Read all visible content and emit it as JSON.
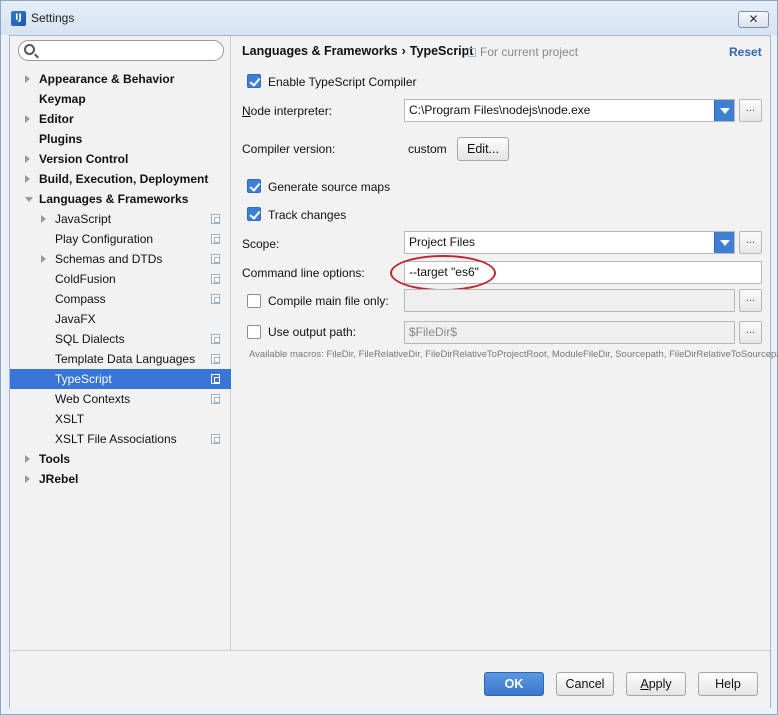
{
  "window": {
    "title": "Settings",
    "close_label": "✕"
  },
  "search": {
    "placeholder": ""
  },
  "tree": {
    "items": [
      {
        "label": "Appearance & Behavior",
        "bold": true,
        "expander": "right",
        "project_icon": false
      },
      {
        "label": "Keymap",
        "bold": true,
        "expander": "none",
        "project_icon": false
      },
      {
        "label": "Editor",
        "bold": true,
        "expander": "right",
        "project_icon": false
      },
      {
        "label": "Plugins",
        "bold": true,
        "expander": "none",
        "project_icon": false
      },
      {
        "label": "Version Control",
        "bold": true,
        "expander": "right",
        "project_icon": false
      },
      {
        "label": "Build, Execution, Deployment",
        "bold": true,
        "expander": "right",
        "project_icon": false
      },
      {
        "label": "Languages & Frameworks",
        "bold": true,
        "expander": "down",
        "project_icon": false
      },
      {
        "label": "JavaScript",
        "bold": false,
        "expander": "right",
        "project_icon": true
      },
      {
        "label": "Play Configuration",
        "bold": false,
        "expander": "none",
        "project_icon": true
      },
      {
        "label": "Schemas and DTDs",
        "bold": false,
        "expander": "right",
        "project_icon": true
      },
      {
        "label": "ColdFusion",
        "bold": false,
        "expander": "none",
        "project_icon": true
      },
      {
        "label": "Compass",
        "bold": false,
        "expander": "none",
        "project_icon": true
      },
      {
        "label": "JavaFX",
        "bold": false,
        "expander": "none",
        "project_icon": false
      },
      {
        "label": "SQL Dialects",
        "bold": false,
        "expander": "none",
        "project_icon": true
      },
      {
        "label": "Template Data Languages",
        "bold": false,
        "expander": "none",
        "project_icon": true
      },
      {
        "label": "TypeScript",
        "bold": false,
        "expander": "none",
        "project_icon": true,
        "selected": true
      },
      {
        "label": "Web Contexts",
        "bold": false,
        "expander": "none",
        "project_icon": true
      },
      {
        "label": "XSLT",
        "bold": false,
        "expander": "none",
        "project_icon": false
      },
      {
        "label": "XSLT File Associations",
        "bold": false,
        "expander": "none",
        "project_icon": true
      },
      {
        "label": "Tools",
        "bold": true,
        "expander": "right",
        "project_icon": false
      },
      {
        "label": "JRebel",
        "bold": true,
        "expander": "right",
        "project_icon": false
      }
    ]
  },
  "header": {
    "crumb_parent": "Languages & Frameworks",
    "crumb_separator": "›",
    "crumb_current": "TypeScript",
    "scope_note": "For current project",
    "reset_label": "Reset"
  },
  "form": {
    "enable_compiler_label": "Enable TypeScript Compiler",
    "enable_compiler_checked": true,
    "node_interpreter_label_first": "N",
    "node_interpreter_label_rest": "ode interpreter:",
    "node_interpreter_value": "C:\\Program Files\\nodejs\\node.exe",
    "dots_label": "...",
    "compiler_version_label": "Compiler version:",
    "compiler_version_value": "custom",
    "edit_label": "Edit...",
    "source_maps_label": "Generate source maps",
    "source_maps_checked": true,
    "track_changes_label": "Track changes",
    "track_changes_checked": true,
    "scope_label": "Scope:",
    "scope_value": "Project Files",
    "cmd_options_label": "Command line options:",
    "cmd_options_value": "--target \"es6\"",
    "compile_main_label": "Compile main file only:",
    "compile_main_checked": false,
    "compile_main_value": "",
    "output_path_label": "Use output path:",
    "output_path_checked": false,
    "output_path_value": "$FileDir$",
    "macros_hint": "Available macros: FileDir, FileRelativeDir, FileDirRelativeToProjectRoot, ModuleFileDir, Sourcepath, FileDirRelativeToSourcepath"
  },
  "footer": {
    "ok_label": "OK",
    "cancel_label": "Cancel",
    "apply_label_first": "A",
    "apply_label_rest": "pply",
    "help_label": "Help"
  },
  "colors": {
    "accent": "#3d7fd3",
    "selection": "#3875d7",
    "annotation": "#c0272d",
    "reset_link": "#2f66b3"
  }
}
